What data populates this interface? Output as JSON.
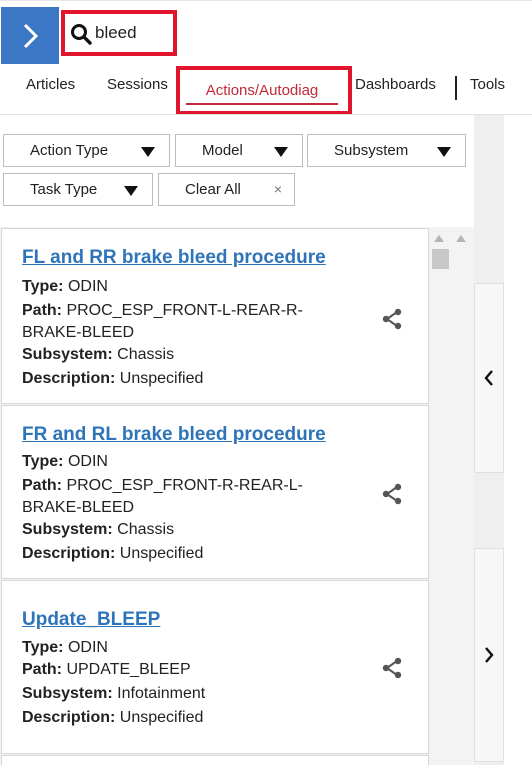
{
  "search": {
    "value": "bleed",
    "placeholder": ""
  },
  "tabs": [
    {
      "label": "Articles"
    },
    {
      "label": "Sessions"
    },
    {
      "label": "Actions/Autodiag",
      "active": true
    },
    {
      "label": "Dashboards"
    },
    {
      "label": "Tools"
    }
  ],
  "filters": {
    "action_type": "Action Type",
    "model": "Model",
    "subsystem": "Subsystem",
    "task_type": "Task Type",
    "clear_all": "Clear All",
    "clear_x": "×"
  },
  "field_labels": {
    "type": "Type:",
    "path": "Path:",
    "subsystem": "Subsystem:",
    "description": "Description:"
  },
  "results": [
    {
      "title": "FL and RR brake bleed procedure",
      "type": "ODIN",
      "path_line1": "PROC_ESP_FRONT-L-REAR-R-",
      "path_line2": "BRAKE-BLEED",
      "subsystem": "Chassis",
      "description": "Unspecified"
    },
    {
      "title": "FR and RL brake bleed procedure",
      "type": "ODIN",
      "path_line1": "PROC_ESP_FRONT-R-REAR-L-",
      "path_line2": "BRAKE-BLEED",
      "subsystem": "Chassis",
      "description": "Unspecified"
    },
    {
      "title": "Update_BLEEP",
      "type": "ODIN",
      "path_line1": "UPDATE_BLEEP",
      "path_line2": "",
      "subsystem": "Infotainment",
      "description": "Unspecified"
    }
  ],
  "colors": {
    "accent_blue": "#3b77c4",
    "link_blue": "#2e74b8",
    "highlight_red": "#e0142c",
    "active_tab_red": "#c2283a"
  },
  "icons": {
    "expand": "chevron-right-icon",
    "search": "search-icon",
    "share": "share-icon",
    "collapse_left": "chevron-left-icon",
    "collapse_right": "chevron-right-icon"
  }
}
